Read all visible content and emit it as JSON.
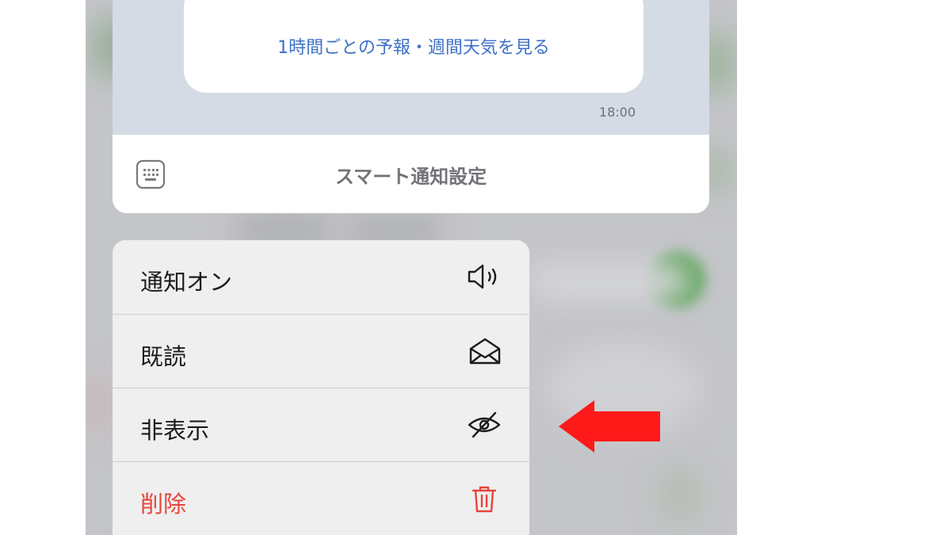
{
  "chat": {
    "forecast_link": "1時間ごとの予報・週間天気を見る",
    "timestamp": "18:00",
    "bottom_bar_label": "スマート通知設定"
  },
  "menu": {
    "items": [
      {
        "label": "通知オン",
        "icon": "speaker-icon",
        "destructive": false
      },
      {
        "label": "既読",
        "icon": "open-envelope-icon",
        "destructive": false
      },
      {
        "label": "非表示",
        "icon": "eye-slash-icon",
        "destructive": false
      },
      {
        "label": "削除",
        "icon": "trash-icon",
        "destructive": true
      }
    ]
  },
  "annotation": {
    "arrow_color": "#ff1a1a",
    "points_to": "非表示"
  },
  "colors": {
    "link_blue": "#3d70c7",
    "destructive_red": "#e8443a",
    "chat_background": "#d4dbe5",
    "menu_background": "#efefef"
  }
}
